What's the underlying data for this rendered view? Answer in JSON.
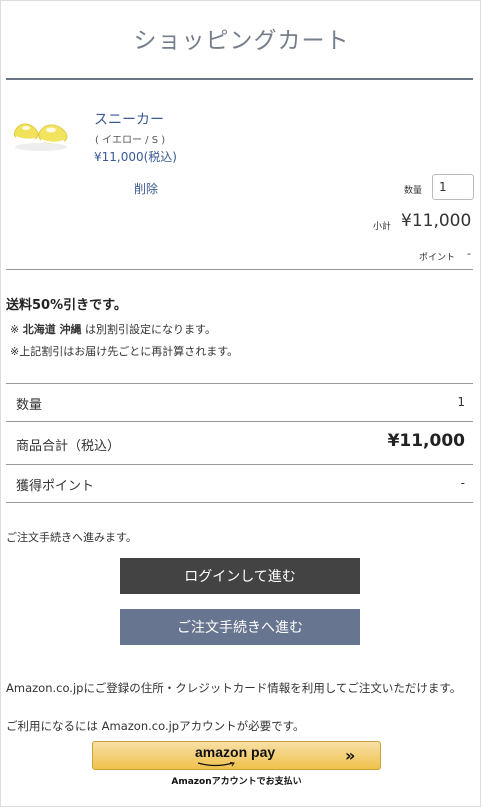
{
  "header": {
    "title": "ショッピングカート"
  },
  "cart_item": {
    "name": "スニーカー",
    "variant": "( イエロー / S )",
    "price": "¥11,000(税込)",
    "delete_label": "削除",
    "quantity_label": "数量",
    "quantity_value": "1",
    "subtotal_label": "小計",
    "subtotal_value": "¥11,000",
    "point_label": "ポイント",
    "point_value": "-"
  },
  "shipping_notice": {
    "title": "送料50%引きです。",
    "note1_prefix": "※ ",
    "note1_region": "北海道 沖縄",
    "note1_suffix": " は別割引設定になります。",
    "note2": "※上記割引はお届け先ごとに再計算されます。"
  },
  "summary": {
    "quantity_label": "数量",
    "quantity_value": "1",
    "total_label": "商品合計（税込）",
    "total_value": "¥11,000",
    "points_label": "獲得ポイント",
    "points_value": "-"
  },
  "checkout": {
    "proceed_text": "ご注文手続きへ進みます。",
    "login_button": "ログインして進む",
    "order_button": "ご注文手続きへ進む"
  },
  "amazon_pay": {
    "info1": "Amazon.co.jpにご登録の住所・クレジットカード情報を利用してご注文いただけます。",
    "info2": "ご利用になるには Amazon.co.jpアカウントが必要です。",
    "brand": "amazon pay",
    "chevron": "»",
    "caption": "Amazonアカウントでお支払い",
    "accent_color": "#f0c14b"
  },
  "colors": {
    "link": "#3a5a95",
    "order_button": "#677590",
    "login_button": "#434343"
  }
}
